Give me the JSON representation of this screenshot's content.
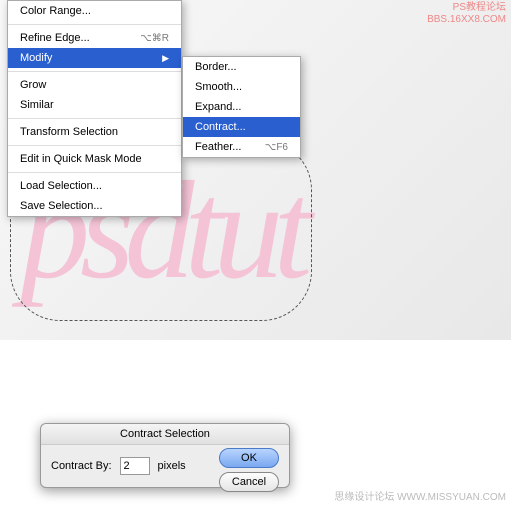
{
  "menu": {
    "items": [
      {
        "label": "Color Range...",
        "shortcut": ""
      },
      {
        "sep": true
      },
      {
        "label": "Refine Edge...",
        "shortcut": "⌥⌘R"
      },
      {
        "label": "Modify",
        "shortcut": "",
        "highlighted": true,
        "submenu": true
      },
      {
        "sep": true
      },
      {
        "label": "Grow",
        "shortcut": ""
      },
      {
        "label": "Similar",
        "shortcut": ""
      },
      {
        "sep": true
      },
      {
        "label": "Transform Selection",
        "shortcut": ""
      },
      {
        "sep": true
      },
      {
        "label": "Edit in Quick Mask Mode",
        "shortcut": ""
      },
      {
        "sep": true
      },
      {
        "label": "Load Selection...",
        "shortcut": ""
      },
      {
        "label": "Save Selection...",
        "shortcut": ""
      }
    ]
  },
  "submenu": {
    "items": [
      {
        "label": "Border...",
        "shortcut": ""
      },
      {
        "label": "Smooth...",
        "shortcut": ""
      },
      {
        "label": "Expand...",
        "shortcut": ""
      },
      {
        "label": "Contract...",
        "shortcut": "",
        "highlighted": true
      },
      {
        "label": "Feather...",
        "shortcut": "⌥F6"
      }
    ]
  },
  "dialog": {
    "title": "Contract Selection",
    "field_label": "Contract By:",
    "value": "2",
    "unit": "pixels",
    "ok": "OK",
    "cancel": "Cancel"
  },
  "canvas": {
    "text": "psdtut"
  },
  "watermark": {
    "top1": "PS教程论坛",
    "top2": "BBS.16XX8.COM",
    "bottom": "思缘设计论坛   WWW.MISSYUAN.COM"
  }
}
